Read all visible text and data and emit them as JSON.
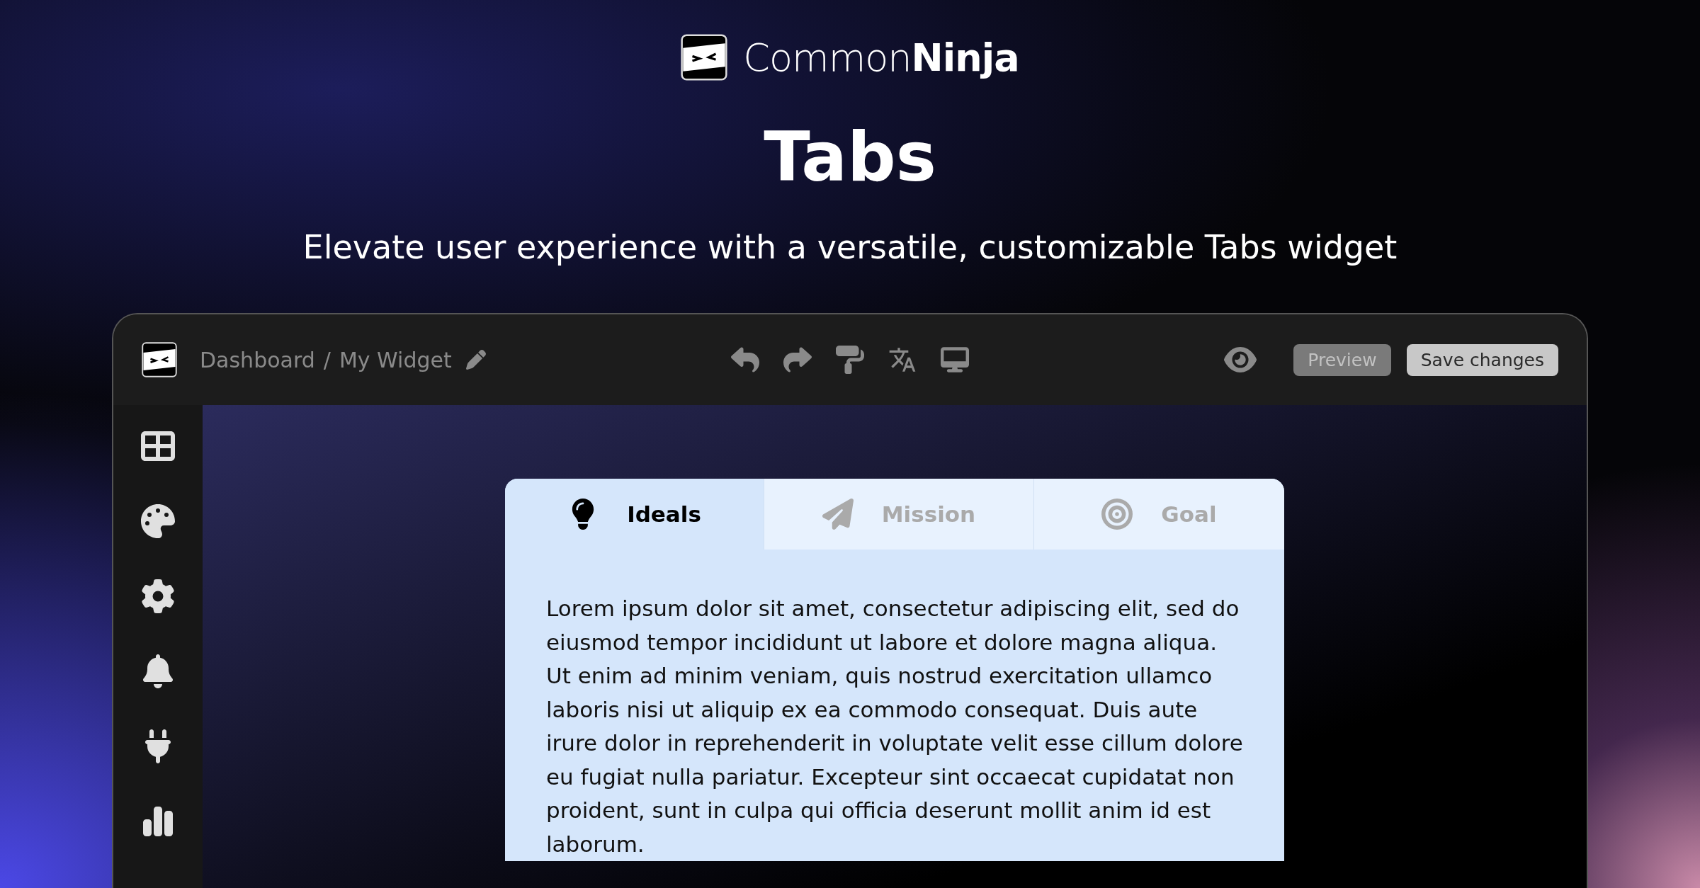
{
  "brand": {
    "name": "Common**Ninja**"
  },
  "headline": "Tabs",
  "subtitle": "Elevate user experience with a versatile, customizable Tabs widget",
  "editor": {
    "breadcrumb": {
      "root": "Dashboard",
      "separator": "/",
      "current": "My Widget"
    },
    "buttons": [
      {
        "label": "Preview",
        "kind": "secondary"
      },
      {
        "label": "Save changes",
        "kind": "primary"
      }
    ],
    "widget": {
      "tabs": [
        {
          "label": "Ideals",
          "selected": true
        },
        {
          "label": "Mission",
          "selected": false
        },
        {
          "label": "Goal",
          "selected": false
        }
      ],
      "body": "Lorem ipsum dolor sit amet, consectetur adipiscing elit, sed do eiusmod tempor incididunt ut labore et dolore magna aliqua. Ut enim ad minim veniam, quis nostrud exercitation ullamco laboris nisi ut aliquip ex ea commodo consequat. Duis aute irure dolor in reprehenderit in voluptate velit esse cillum dolore eu fugiat nulla pariatur. Excepteur sint occaecat cupidatat non proident, sunt in culpa qui officia deserunt mollit anim id est laborum."
    }
  }
}
